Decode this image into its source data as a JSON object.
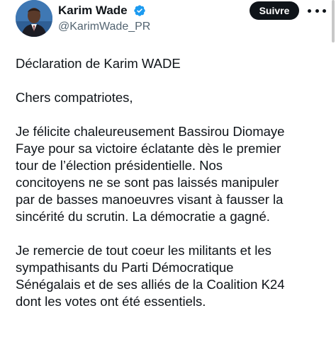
{
  "author": {
    "display_name": "Karim Wade",
    "handle": "@KarimWade_PR",
    "verified": true,
    "verified_color": "#1d9bf0"
  },
  "actions": {
    "follow_label": "Suivre"
  },
  "body": {
    "p1": "Déclaration de Karim WADE",
    "p2": "Chers compatriotes,",
    "p3": "Je félicite chaleureusement Bassirou Diomaye\nFaye pour sa victoire éclatante dès le premier\ntour de l’élection présidentielle. Nos\nconcitoyens ne se sont pas laissés manipuler\npar de basses manoeuvres visant à fausser la\nsincérité du scrutin. La démocratie a gagné.",
    "p4": "Je remercie de tout coeur les militants et les\nsympathisants du Parti Démocratique\nSénégalais et de ses alliés de la Coalition K24\ndont les votes ont été essentiels."
  },
  "colors": {
    "text": "#0f1419",
    "secondary_text": "#536471",
    "button_bg": "#0f1419",
    "button_text": "#ffffff"
  }
}
